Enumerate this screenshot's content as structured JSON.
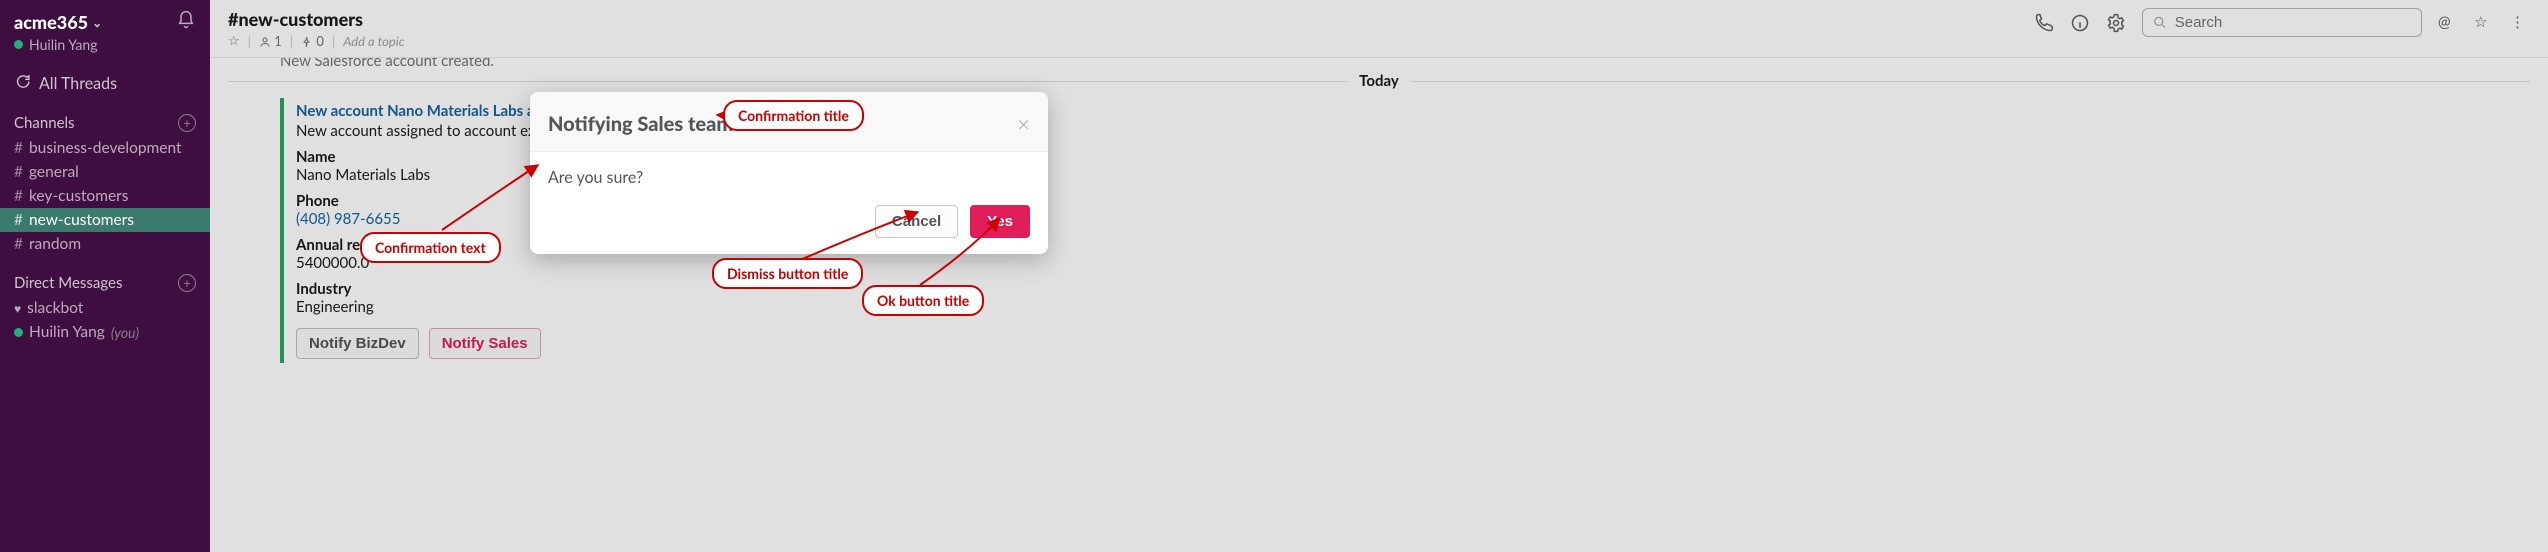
{
  "sidebar": {
    "team_name": "acme365",
    "user_name": "Huilin Yang",
    "all_threads": "All Threads",
    "channels_label": "Channels",
    "channels": [
      {
        "label": "business-development"
      },
      {
        "label": "general"
      },
      {
        "label": "key-customers"
      },
      {
        "label": "new-customers"
      },
      {
        "label": "random"
      }
    ],
    "dm_label": "Direct Messages",
    "dms": [
      {
        "label": "slackbot"
      },
      {
        "label": "Huilin Yang",
        "you": "(you)"
      }
    ]
  },
  "header": {
    "channel": "#new-customers",
    "members": "1",
    "pins": "0",
    "add_topic": "Add a topic",
    "search_placeholder": "Search"
  },
  "divider": {
    "today": "Today"
  },
  "message": {
    "cut": "New Salesforce account created.",
    "title": "New account Nano Materials Labs added in Salesforce.",
    "sub_prefix": "New account assigned to account execu",
    "fields": {
      "name_label": "Name",
      "name_value": "Nano Materials Labs",
      "phone_label": "Phone",
      "phone_value": "(408) 987-6655",
      "rev_label": "Annual revenue",
      "rev_value": "5400000.0",
      "ind_label": "Industry",
      "ind_value": "Engineering"
    },
    "buttons": {
      "bizdev": "Notify BizDev",
      "sales": "Notify Sales"
    }
  },
  "modal": {
    "title": "Notifying Sales team",
    "body": "Are you sure?",
    "cancel": "Cancel",
    "ok": "Yes"
  },
  "annotations": {
    "conf_title": "Confirmation title",
    "conf_text": "Confirmation text",
    "dismiss": "Dismiss button title",
    "ok": "Ok button title"
  }
}
